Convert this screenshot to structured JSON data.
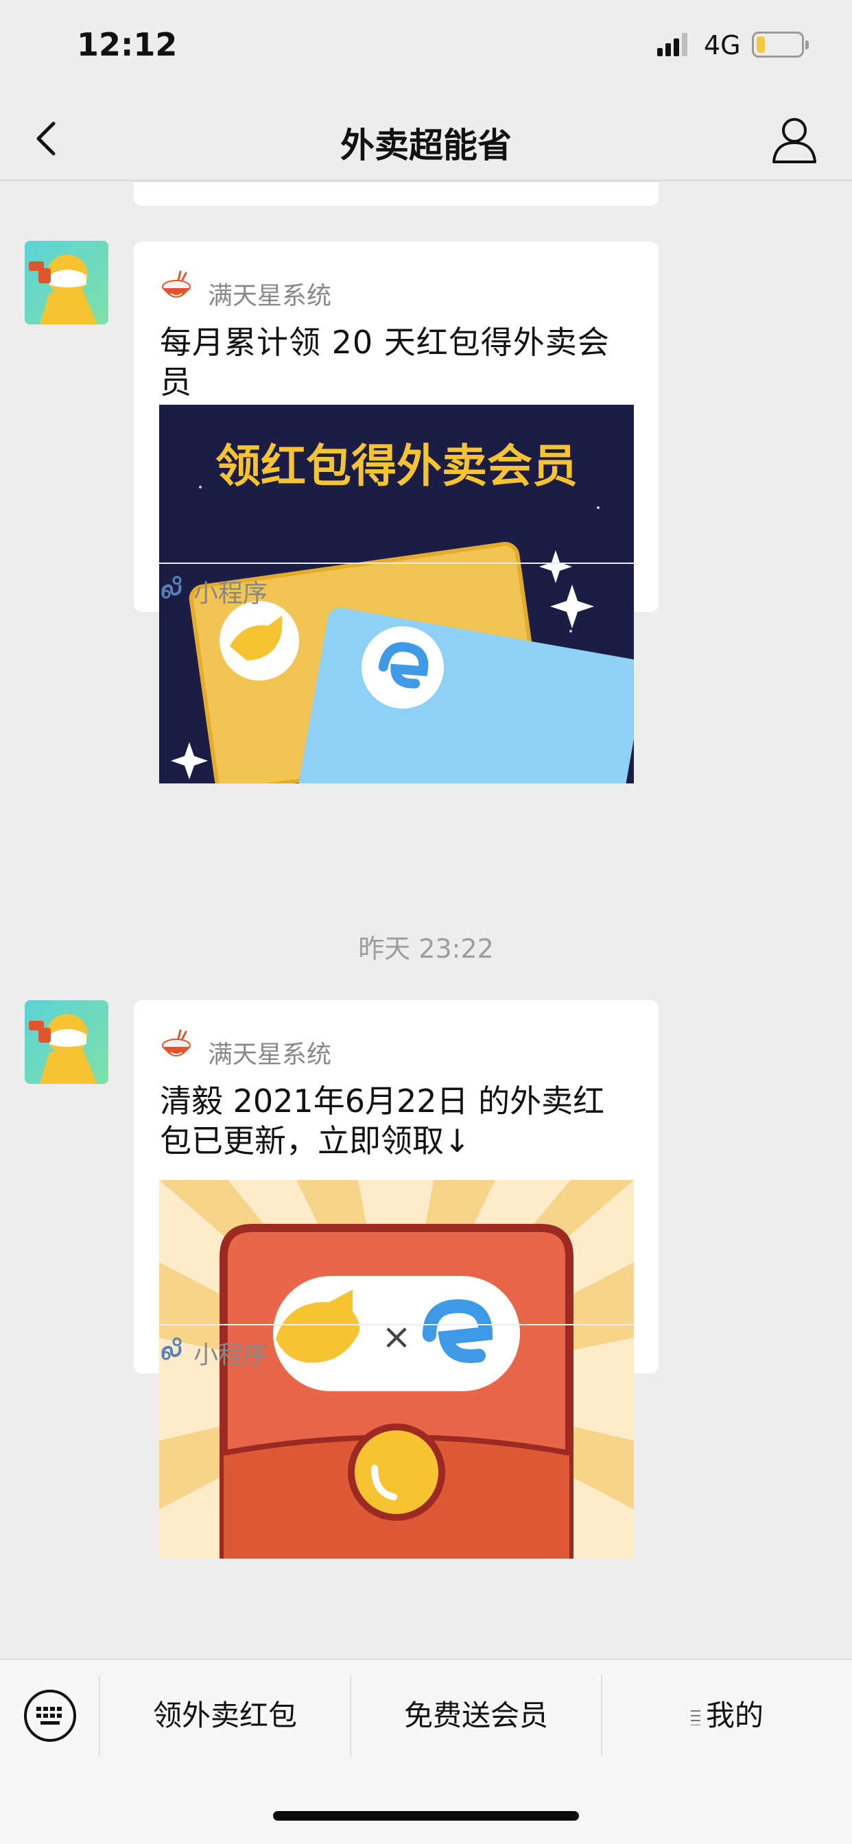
{
  "status_bar": {
    "time": "12:12",
    "network": "4G",
    "battery_level": 0.2
  },
  "nav": {
    "title": "外卖超能省",
    "back_icon": "chevron-left-icon",
    "profile_icon": "user-icon"
  },
  "messages": [
    {
      "source_name": "满天星系统",
      "title": "每月累计领 20 天红包得外卖会员",
      "image_text": "领红包得外卖会员",
      "footer_label": "小程序"
    },
    {
      "timestamp": "昨天 23:22"
    },
    {
      "source_name": "满天星系统",
      "title": "清毅  2021年6月22日 的外卖红包已更新，立即领取↓",
      "image_text": "×",
      "footer_label": "小程序"
    }
  ],
  "menu": {
    "keyboard_icon": "keyboard-icon",
    "items": [
      "领外卖红包",
      "免费送会员",
      "我的"
    ]
  },
  "colors": {
    "background": "#ededed",
    "card": "#ffffff",
    "accent_yellow": "#f6c333",
    "accent_blue": "#3e9ae6",
    "envelope_red": "#e8674a"
  }
}
